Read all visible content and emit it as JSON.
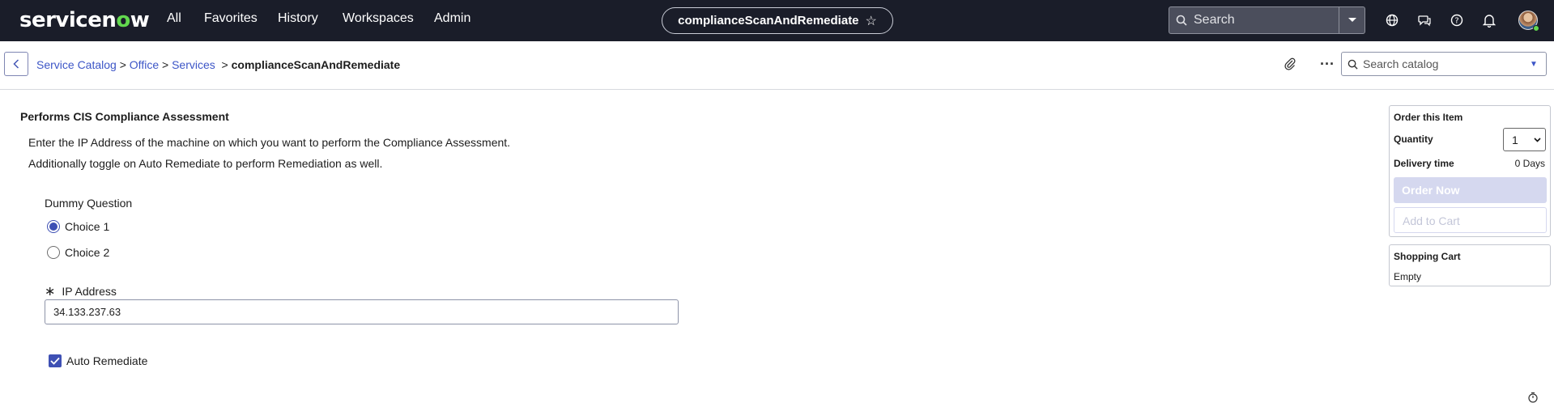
{
  "topbar": {
    "logo_prefix": "servicen",
    "logo_o": "o",
    "logo_suffix": "w",
    "nav": [
      "All",
      "Favorites",
      "History",
      "Workspaces",
      "Admin"
    ],
    "page_title": "complianceScanAndRemediate",
    "search_placeholder": "Search",
    "icons": [
      "globe-icon",
      "chat-icon",
      "help-icon",
      "bell-icon",
      "avatar"
    ]
  },
  "breadcrumb": {
    "items": [
      "Service Catalog",
      "Office",
      "Services"
    ],
    "separator": ">",
    "current": "complianceScanAndRemediate"
  },
  "catalog_search": {
    "placeholder": "Search catalog"
  },
  "form": {
    "title": "Performs CIS Compliance Assessment",
    "description_line1": "Enter the IP Address of the machine on which you want to perform the Compliance Assessment.",
    "description_line2": "Additionally toggle on Auto Remediate to perform Remediation as well.",
    "question_label": "Dummy Question",
    "choices": [
      {
        "label": "Choice 1",
        "selected": true
      },
      {
        "label": "Choice 2",
        "selected": false
      }
    ],
    "ip_required_mark": "∗",
    "ip_label": "IP Address",
    "ip_value": "34.133.237.63",
    "auto_remediate_label": "Auto Remediate",
    "auto_remediate_checked": true
  },
  "order_panel": {
    "title": "Order this Item",
    "quantity_label": "Quantity",
    "quantity_value": "1",
    "delivery_label": "Delivery time",
    "delivery_value": "0 Days",
    "order_button": "Order Now",
    "cart_button": "Add to Cart"
  },
  "cart_panel": {
    "title": "Shopping Cart",
    "status": "Empty"
  },
  "colors": {
    "topbar_bg": "#1a1d29",
    "accent": "#3e50b4",
    "link": "#3d56c7",
    "logo_green": "#62d84e"
  }
}
